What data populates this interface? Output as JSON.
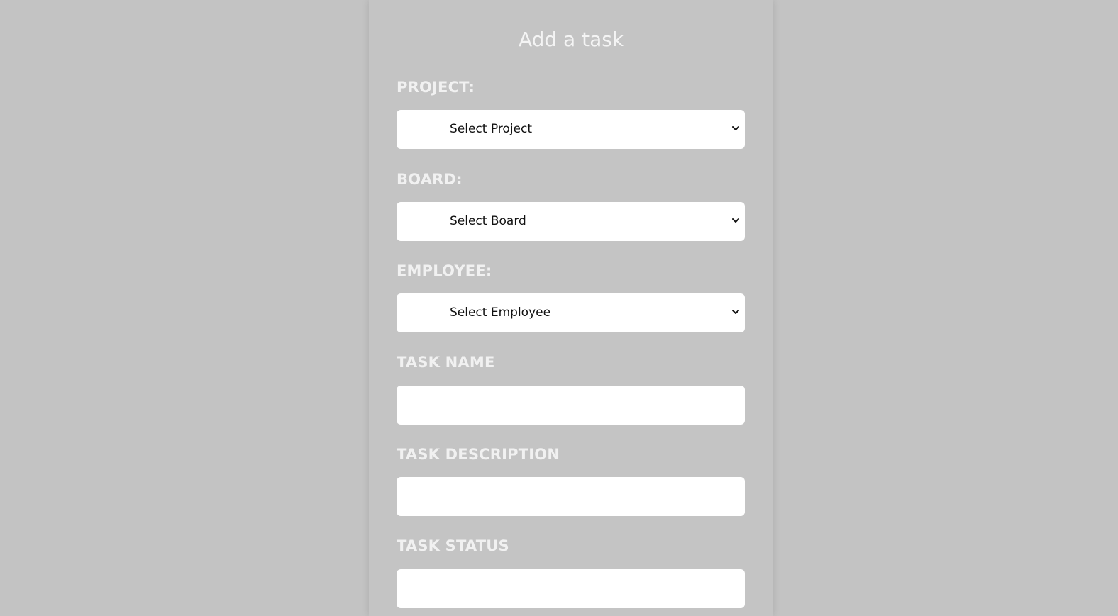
{
  "form": {
    "title": "Add a task",
    "project": {
      "label": "PROJECT:",
      "selected": "Select Project"
    },
    "board": {
      "label": "BOARD:",
      "selected": "Select Board"
    },
    "employee": {
      "label": "EMPLOYEE:",
      "selected": "Select Employee"
    },
    "task_name": {
      "label": "TASK NAME",
      "value": "",
      "placeholder": ""
    },
    "task_description": {
      "label": "TASK DESCRIPTION",
      "value": "",
      "placeholder": ""
    },
    "task_status": {
      "label": "TASK STATUS",
      "value": "",
      "placeholder": ""
    }
  },
  "icons": {
    "dropdown": "chevron-down-icon"
  },
  "colors": {
    "page_background": "#c3c3c3",
    "panel_background": "#c4c4c4",
    "label_text": "#f1f1f1",
    "field_background": "#ffffff"
  }
}
